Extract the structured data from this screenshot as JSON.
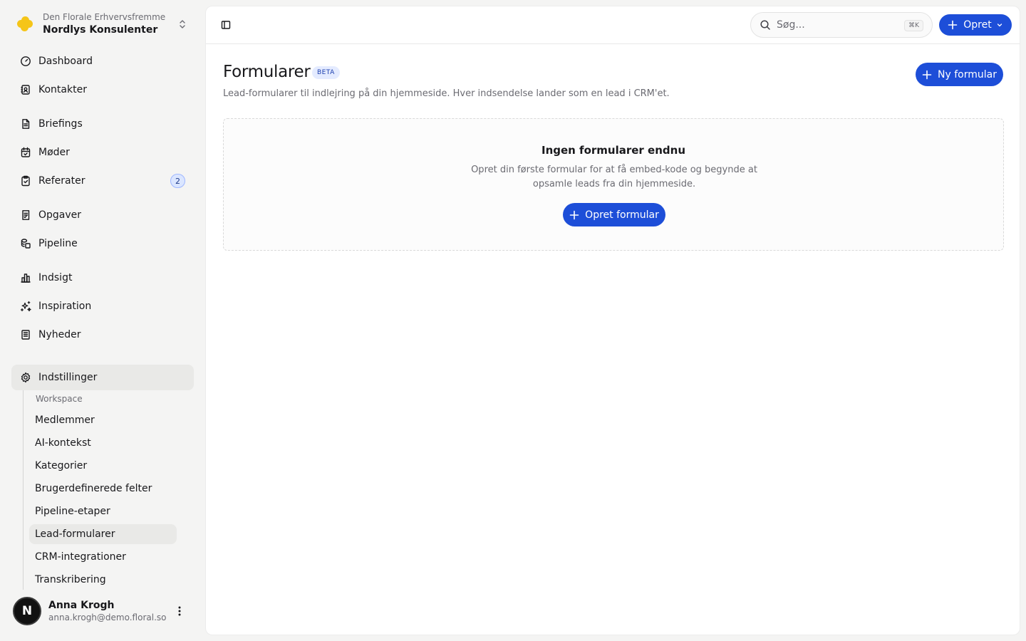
{
  "workspace": {
    "org": "Den Florale Erhvervsfremme",
    "name": "Nordlys Konsulenter"
  },
  "nav": {
    "dashboard": "Dashboard",
    "kontakter": "Kontakter",
    "briefings": "Briefings",
    "moder": "Møder",
    "referater": "Referater",
    "referater_badge": "2",
    "opgaver": "Opgaver",
    "pipeline": "Pipeline",
    "indsigt": "Indsigt",
    "inspiration": "Inspiration",
    "nyheder": "Nyheder",
    "indstillinger": "Indstillinger"
  },
  "settings_nav": {
    "section": "Workspace",
    "items": [
      "Medlemmer",
      "AI-kontekst",
      "Kategorier",
      "Brugerdefinerede felter",
      "Pipeline-etaper",
      "Lead-formularer",
      "CRM-integrationer",
      "Transkribering"
    ],
    "active": "Lead-formularer"
  },
  "user": {
    "initial": "N",
    "name": "Anna Krogh",
    "email": "anna.krogh@demo.floral.so"
  },
  "topbar": {
    "search_placeholder": "Søg...",
    "search_shortcut": "⌘K",
    "create_label": "Opret"
  },
  "page": {
    "title": "Formularer",
    "badge": "BETA",
    "subtitle": "Lead-formularer til indlejring på din hjemmeside. Hver indsendelse lander som en lead i CRM'et.",
    "new_button": "Ny formular"
  },
  "empty_state": {
    "title": "Ingen formularer endnu",
    "description": "Opret din første formular for at få embed-kode og begynde at opsamle leads fra din hjemmeside.",
    "button": "Opret formular"
  },
  "colors": {
    "primary": "#1d4ed8",
    "sidebar_bg": "#f4f4f3",
    "logo": "#f5c518"
  }
}
